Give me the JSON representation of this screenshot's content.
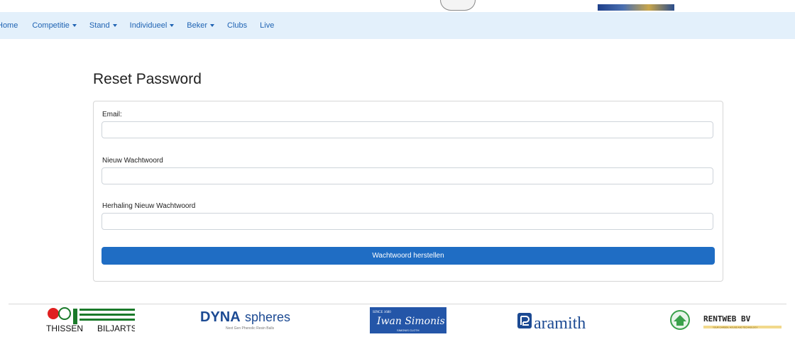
{
  "nav": {
    "items": [
      {
        "label": "Home",
        "dropdown": false
      },
      {
        "label": "Competitie",
        "dropdown": true
      },
      {
        "label": "Stand",
        "dropdown": true
      },
      {
        "label": "Individueel",
        "dropdown": true
      },
      {
        "label": "Beker",
        "dropdown": true
      },
      {
        "label": "Clubs",
        "dropdown": false
      },
      {
        "label": "Live",
        "dropdown": false
      }
    ]
  },
  "page": {
    "title": "Reset Password"
  },
  "form": {
    "email_label": "Email:",
    "email_value": "",
    "new_password_label": "Nieuw Wachtwoord",
    "new_password_value": "",
    "repeat_password_label": "Herhaling Nieuw Wachtwoord",
    "repeat_password_value": "",
    "submit_label": "Wachtwoord herstellen"
  },
  "sponsors": {
    "thissen": {
      "left": "THISSEN",
      "right": "BILJARTS"
    },
    "dyna": {
      "dyna": "DYNA",
      "spheres": "spheres",
      "tagline": "Next Gen Phenolic Resin Balls"
    },
    "simonis": {
      "since": "SINCE 1680",
      "script": "Iwan Simonis",
      "cloth": "SIMONIS CLOTH"
    },
    "aramith": {
      "name": "aramith"
    },
    "rentweb": {
      "name": "RENTWEB BV",
      "tagline": "YOUR GARDEN, HOUSE AND TECHNOLOGY"
    }
  },
  "colors": {
    "navbar_bg": "#e3f0fb",
    "link": "#1f63b3",
    "primary_button": "#1f6dc4"
  }
}
